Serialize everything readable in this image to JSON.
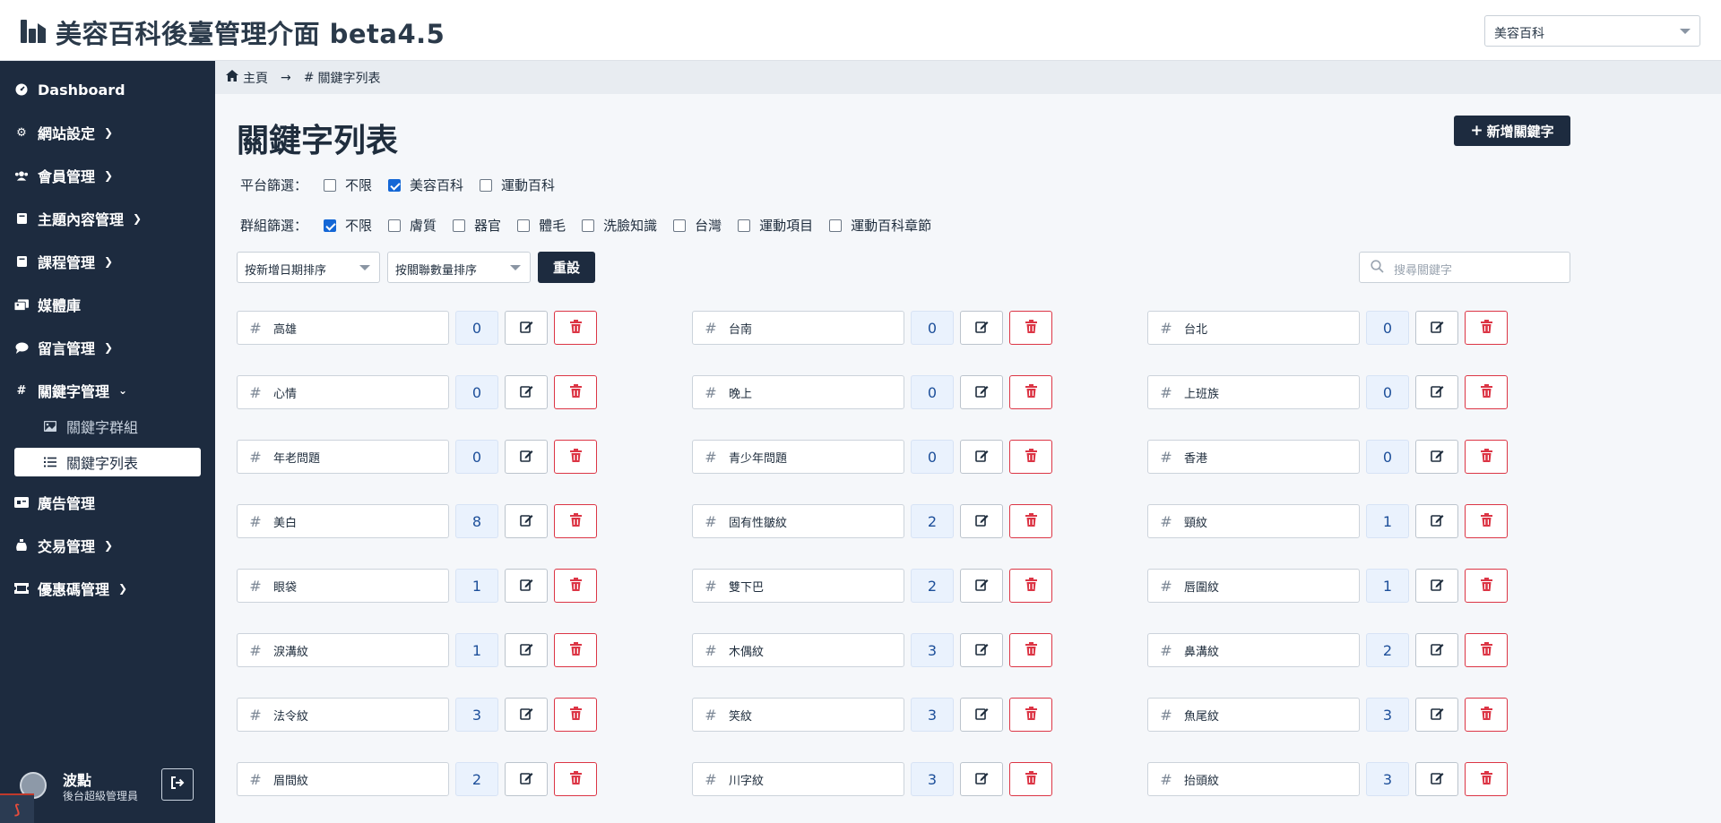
{
  "app": {
    "title": "美容百科後臺管理介面 beta4.5",
    "site_selector": "美容百科"
  },
  "sidebar": {
    "items": [
      {
        "label": "Dashboard",
        "icon": "dashboard-icon",
        "has_chevron": false
      },
      {
        "label": "網站設定",
        "icon": "gear-icon",
        "has_chevron": true
      },
      {
        "label": "會員管理",
        "icon": "users-icon",
        "has_chevron": true
      },
      {
        "label": "主題內容管理",
        "icon": "book-icon",
        "has_chevron": true
      },
      {
        "label": "課程管理",
        "icon": "book-icon",
        "has_chevron": true
      },
      {
        "label": "媒體庫",
        "icon": "images-icon",
        "has_chevron": false
      },
      {
        "label": "留言管理",
        "icon": "comment-icon",
        "has_chevron": true
      },
      {
        "label": "關鍵字管理",
        "icon": "hashtag-icon",
        "has_chevron": true
      },
      {
        "label": "廣告管理",
        "icon": "ad-icon",
        "has_chevron": false
      },
      {
        "label": "交易管理",
        "icon": "money-bag-icon",
        "has_chevron": true
      },
      {
        "label": "優惠碼管理",
        "icon": "ticket-icon",
        "has_chevron": true
      }
    ],
    "sub_items": [
      {
        "label": "關鍵字群組",
        "icon": "image-icon",
        "active": false
      },
      {
        "label": "關鍵字列表",
        "icon": "list-icon",
        "active": true
      }
    ],
    "user": {
      "name": "波點",
      "role": "後台超級管理員"
    }
  },
  "breadcrumb": {
    "home": "主頁",
    "current": "關鍵字列表"
  },
  "main": {
    "title": "關鍵字列表",
    "add_button": "新增關鍵字",
    "platform_filter": {
      "label": "平台篩選：",
      "options": [
        {
          "label": "不限",
          "checked": false
        },
        {
          "label": "美容百科",
          "checked": true
        },
        {
          "label": "運動百科",
          "checked": false
        }
      ]
    },
    "group_filter": {
      "label": "群組篩選：",
      "options": [
        {
          "label": "不限",
          "checked": true
        },
        {
          "label": "膚質",
          "checked": false
        },
        {
          "label": "器官",
          "checked": false
        },
        {
          "label": "體毛",
          "checked": false
        },
        {
          "label": "洗臉知識",
          "checked": false
        },
        {
          "label": "台灣",
          "checked": false
        },
        {
          "label": "運動項目",
          "checked": false
        },
        {
          "label": "運動百科章節",
          "checked": false
        }
      ]
    },
    "sort_date": "按新增日期排序",
    "sort_count": "按關聯數量排序",
    "reset_button": "重設",
    "search_placeholder": "搜尋關鍵字",
    "keywords": [
      {
        "name": "高雄",
        "count": 0
      },
      {
        "name": "台南",
        "count": 0
      },
      {
        "name": "台北",
        "count": 0
      },
      {
        "name": "心情",
        "count": 0
      },
      {
        "name": "晚上",
        "count": 0
      },
      {
        "name": "上班族",
        "count": 0
      },
      {
        "name": "年老問題",
        "count": 0
      },
      {
        "name": "青少年問題",
        "count": 0
      },
      {
        "name": "香港",
        "count": 0
      },
      {
        "name": "美白",
        "count": 8
      },
      {
        "name": "固有性皺紋",
        "count": 2
      },
      {
        "name": "頸紋",
        "count": 1
      },
      {
        "name": "眼袋",
        "count": 1
      },
      {
        "name": "雙下巴",
        "count": 2
      },
      {
        "name": "唇圍紋",
        "count": 1
      },
      {
        "name": "淚溝紋",
        "count": 1
      },
      {
        "name": "木偶紋",
        "count": 3
      },
      {
        "name": "鼻溝紋",
        "count": 2
      },
      {
        "name": "法令紋",
        "count": 3
      },
      {
        "name": "笑紋",
        "count": 3
      },
      {
        "name": "魚尾紋",
        "count": 3
      },
      {
        "name": "眉間紋",
        "count": 2
      },
      {
        "name": "川字紋",
        "count": 3
      },
      {
        "name": "抬頭紋",
        "count": 3
      }
    ]
  },
  "colors": {
    "sidebar_bg": "#1d2b3f",
    "accent": "#1d2b3f",
    "danger": "#dc3545",
    "checkbox": "#1467d6"
  }
}
